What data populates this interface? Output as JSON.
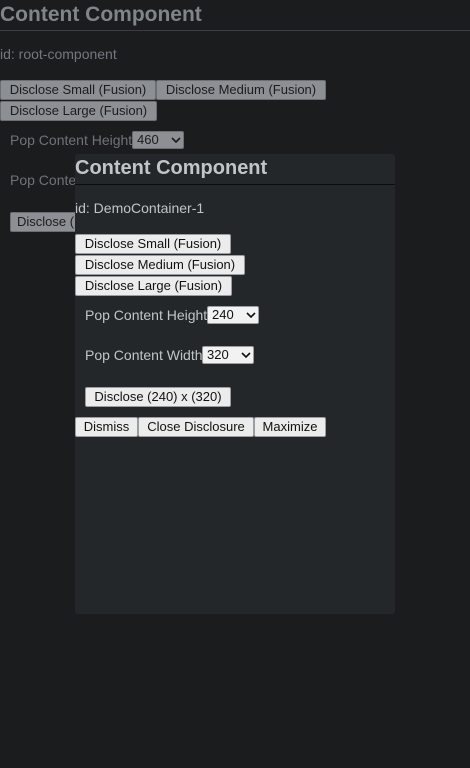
{
  "root": {
    "title": "Content Component",
    "id_text": "id: root-component",
    "buttons": {
      "small": "Disclose Small (Fusion)",
      "medium": "Disclose Medium (Fusion)",
      "large": "Disclose Large (Fusion)"
    },
    "height_label": "Pop Content Height",
    "height_value": "460",
    "width_label": "Pop Conte",
    "disclose_label": "Disclose ("
  },
  "panel": {
    "title": "Content Component",
    "id_text": "id: DemoContainer-1",
    "buttons": {
      "small": "Disclose Small (Fusion)",
      "medium": "Disclose Medium (Fusion)",
      "large": "Disclose Large (Fusion)"
    },
    "height_label": "Pop Content Height",
    "height_value": "240",
    "width_label": "Pop Content Width",
    "width_value": "320",
    "disclose_label": "Disclose (240) x (320)",
    "actions": {
      "dismiss": "Dismiss",
      "close": "Close Disclosure",
      "maximize": "Maximize"
    }
  },
  "icons": {
    "select_arrow": "chevron-down-icon"
  },
  "colors": {
    "page_background": "#1a1c1e",
    "panel_background": "#24272a"
  }
}
